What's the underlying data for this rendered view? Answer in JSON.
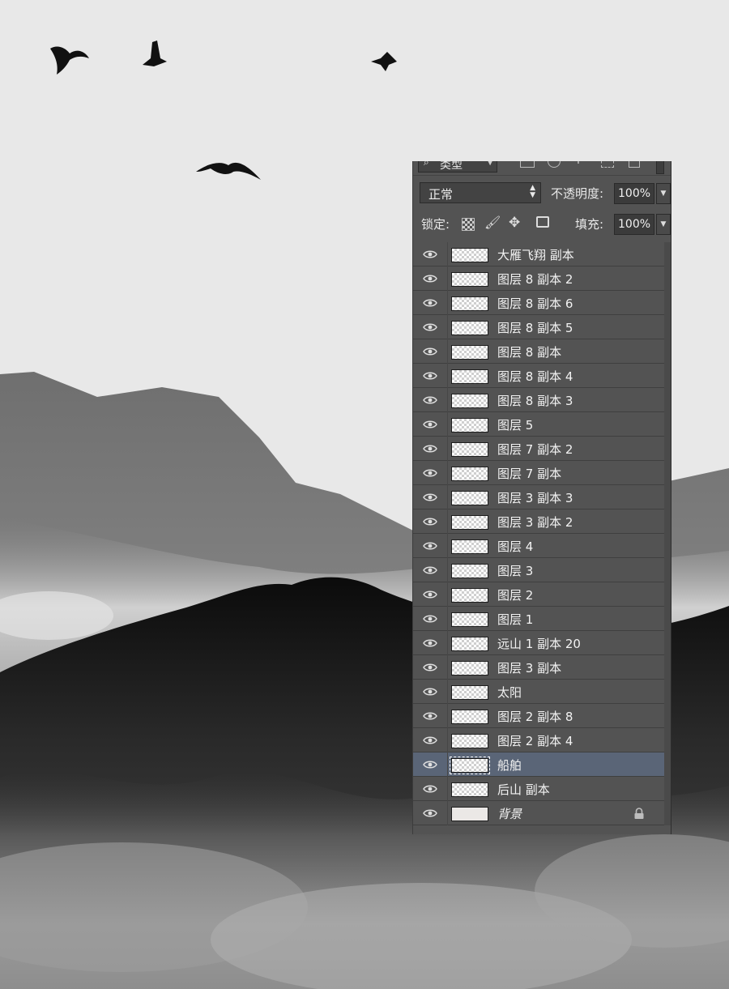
{
  "panel": {
    "filter": {
      "kind_label": "类型"
    },
    "blend": {
      "mode": "正常",
      "opacity_label": "不透明度:",
      "opacity_value": "100%"
    },
    "lock": {
      "label": "锁定:",
      "fill_label": "填充:",
      "fill_value": "100%"
    },
    "layers": [
      {
        "name": "大雁飞翔 副本",
        "visible": true
      },
      {
        "name": "图层 8 副本 2",
        "visible": true
      },
      {
        "name": "图层 8 副本 6",
        "visible": true
      },
      {
        "name": "图层 8 副本 5",
        "visible": true
      },
      {
        "name": "图层 8 副本",
        "visible": true
      },
      {
        "name": "图层 8 副本 4",
        "visible": true
      },
      {
        "name": "图层 8 副本 3",
        "visible": true
      },
      {
        "name": "图层 5",
        "visible": true
      },
      {
        "name": "图层 7 副本 2",
        "visible": true
      },
      {
        "name": "图层 7 副本",
        "visible": true
      },
      {
        "name": "图层 3 副本 3",
        "visible": true
      },
      {
        "name": "图层 3 副本 2",
        "visible": true
      },
      {
        "name": "图层 4",
        "visible": true
      },
      {
        "name": "图层 3",
        "visible": true
      },
      {
        "name": "图层 2",
        "visible": true
      },
      {
        "name": "图层 1",
        "visible": true
      },
      {
        "name": "远山 1 副本 20",
        "visible": true
      },
      {
        "name": "图层 3 副本",
        "visible": true
      },
      {
        "name": "太阳",
        "visible": true
      },
      {
        "name": "图层 2 副本 8",
        "visible": true
      },
      {
        "name": "图层 2 副本 4",
        "visible": true
      },
      {
        "name": "船舶",
        "visible": true,
        "selected": true
      },
      {
        "name": "后山 副本",
        "visible": true
      },
      {
        "name": "背景",
        "visible": true,
        "locked": true,
        "background": true
      }
    ]
  },
  "colors": {
    "panel_bg": "#535353",
    "selected_bg": "#5a6577",
    "canvas_bg": "#e8e8e8"
  }
}
